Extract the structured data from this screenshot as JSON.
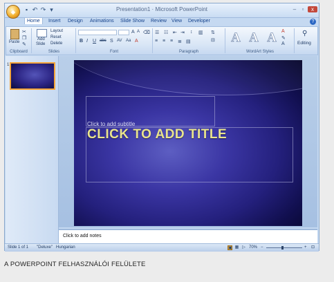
{
  "window": {
    "title": "Presentation1 · Microsoft PowerPoint",
    "controls": {
      "minimize": "–",
      "maximize": "▫",
      "close": "x"
    }
  },
  "quick_access": [
    {
      "name": "save-icon",
      "glyph": "▪"
    },
    {
      "name": "undo-icon",
      "glyph": "↶"
    },
    {
      "name": "redo-icon",
      "glyph": "↷"
    },
    {
      "name": "customize-icon",
      "glyph": "▾"
    }
  ],
  "tabs": [
    "Home",
    "Insert",
    "Design",
    "Animations",
    "Slide Show",
    "Review",
    "View",
    "Developer"
  ],
  "active_tab": "Home",
  "ribbon": {
    "clipboard": {
      "paste": "Paste",
      "label": "Clipboard"
    },
    "slides": {
      "add_slide": "Add",
      "add_slide_2": "Slide",
      "layout": "Layout",
      "reset": "Reset",
      "delete": "Delete",
      "label": "Slides"
    },
    "font": {
      "label": "Font",
      "bold": "B",
      "italic": "I",
      "underline": "U",
      "strike": "abc",
      "shadow": "S",
      "spacing": "AV",
      "case": "Aa",
      "color": "A"
    },
    "paragraph": {
      "label": "Paragraph"
    },
    "wordart": {
      "label": "WordArt Styles",
      "letters": [
        "A",
        "A",
        "A"
      ]
    },
    "editing": {
      "label": "Editing"
    }
  },
  "slides_panel": {
    "thumb_number": "1"
  },
  "slide": {
    "subtitle_placeholder": "Click to add subtitle",
    "title_placeholder": "CLICK TO ADD TITLE"
  },
  "notes_placeholder": "Click to add notes",
  "status": {
    "slide_count": "Slide 1 of 1",
    "theme": "\"Deluxe\"",
    "language": "Hungarian",
    "zoom": "70%",
    "zoom_out": "−",
    "zoom_in": "+"
  },
  "colors": {
    "accent_orange": "#f3b543",
    "ribbon_blue": "#c5d9f1",
    "title_text": "#e9e48d"
  },
  "caption": "A POWERPOINT FELHASZNÁLÓI FELÜLETE"
}
